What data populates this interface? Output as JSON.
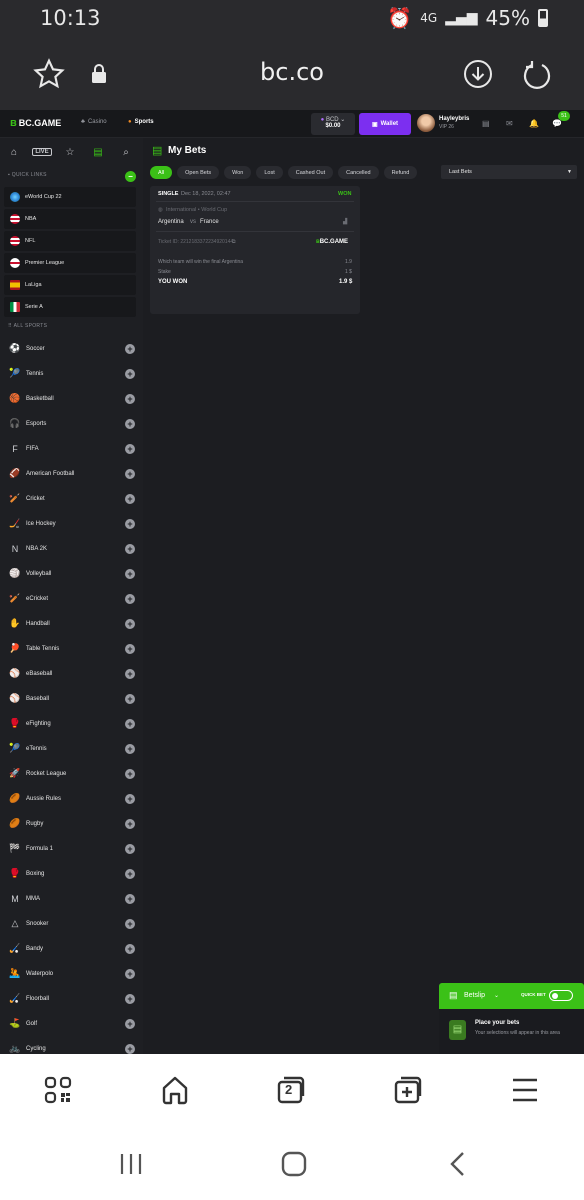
{
  "status_bar": {
    "time": "10:13",
    "network": "4G",
    "battery": "45%"
  },
  "browser": {
    "url": "bc.co"
  },
  "header": {
    "logo": "BC.GAME",
    "nav": [
      "Casino",
      "Sports"
    ],
    "balance_currency": "BCD",
    "balance_amount": "$0.00",
    "wallet_label": "Wallet",
    "username": "Hayleybris",
    "vip": "VIP 26",
    "notification_count": "51"
  },
  "sidebar": {
    "quick_links_title": "QUICK LINKS",
    "quick_links": [
      {
        "label": "eWorld Cup 22",
        "color": "#3c8dde"
      },
      {
        "label": "NBA",
        "color": "#c8102e"
      },
      {
        "label": "NFL",
        "color": "#c8102e"
      },
      {
        "label": "Premier League",
        "color": "#ffffff"
      },
      {
        "label": "LaLiga",
        "color": "#f1bf00"
      },
      {
        "label": "Serie A",
        "color": "#009246"
      }
    ],
    "all_sports_title": "ALL SPORTS",
    "sports": [
      {
        "label": "Soccer",
        "icon": "⚽"
      },
      {
        "label": "Tennis",
        "icon": "🎾"
      },
      {
        "label": "Basketball",
        "icon": "🏀"
      },
      {
        "label": "Esports",
        "icon": "🎧"
      },
      {
        "label": "FIFA",
        "icon": "F"
      },
      {
        "label": "American Football",
        "icon": "🏈"
      },
      {
        "label": "Cricket",
        "icon": "🏏"
      },
      {
        "label": "Ice Hockey",
        "icon": "🏒"
      },
      {
        "label": "NBA 2K",
        "icon": "N"
      },
      {
        "label": "Volleyball",
        "icon": "🏐"
      },
      {
        "label": "eCricket",
        "icon": "🏏"
      },
      {
        "label": "Handball",
        "icon": "✋"
      },
      {
        "label": "Table Tennis",
        "icon": "🏓"
      },
      {
        "label": "eBaseball",
        "icon": "⚾"
      },
      {
        "label": "Baseball",
        "icon": "⚾"
      },
      {
        "label": "eFighting",
        "icon": "🥊"
      },
      {
        "label": "eTennis",
        "icon": "🎾"
      },
      {
        "label": "Rocket League",
        "icon": "🚀"
      },
      {
        "label": "Aussie Rules",
        "icon": "🏉"
      },
      {
        "label": "Rugby",
        "icon": "🏉"
      },
      {
        "label": "Formula 1",
        "icon": "🏁"
      },
      {
        "label": "Boxing",
        "icon": "🥊"
      },
      {
        "label": "MMA",
        "icon": "M"
      },
      {
        "label": "Snooker",
        "icon": "△"
      },
      {
        "label": "Bandy",
        "icon": "🏑"
      },
      {
        "label": "Waterpolo",
        "icon": "🤽"
      },
      {
        "label": "Floorball",
        "icon": "🏑"
      },
      {
        "label": "Golf",
        "icon": "⛳"
      },
      {
        "label": "Cycling",
        "icon": "🚲"
      }
    ]
  },
  "main": {
    "title": "My Bets",
    "filters": [
      "All",
      "Open Bets",
      "Won",
      "Lost",
      "Cashed Out",
      "Cancelled",
      "Refund"
    ],
    "sort": "Last Bets",
    "bet": {
      "type": "SINGLE",
      "date": "Dec 18, 2022, 02:47",
      "status": "WON",
      "league": "International • World Cup",
      "home": "Argentina",
      "vs": "vs",
      "away": "France",
      "ticket": "Ticket ID: 2212183372234920144",
      "brand": "BC.GAME",
      "market": "Which team will win the final Argentina",
      "odds": "1.9",
      "stake_label": "Stake",
      "stake": "1 $",
      "result_label": "YOU WON",
      "payout": "1.9 $"
    }
  },
  "betslip": {
    "title": "Betslip",
    "quick_bet": "QUICK BET",
    "heading": "Place your bets",
    "subtext": "Your selections will appear in this area"
  },
  "browser_bar": {
    "tabs_count": "2"
  }
}
